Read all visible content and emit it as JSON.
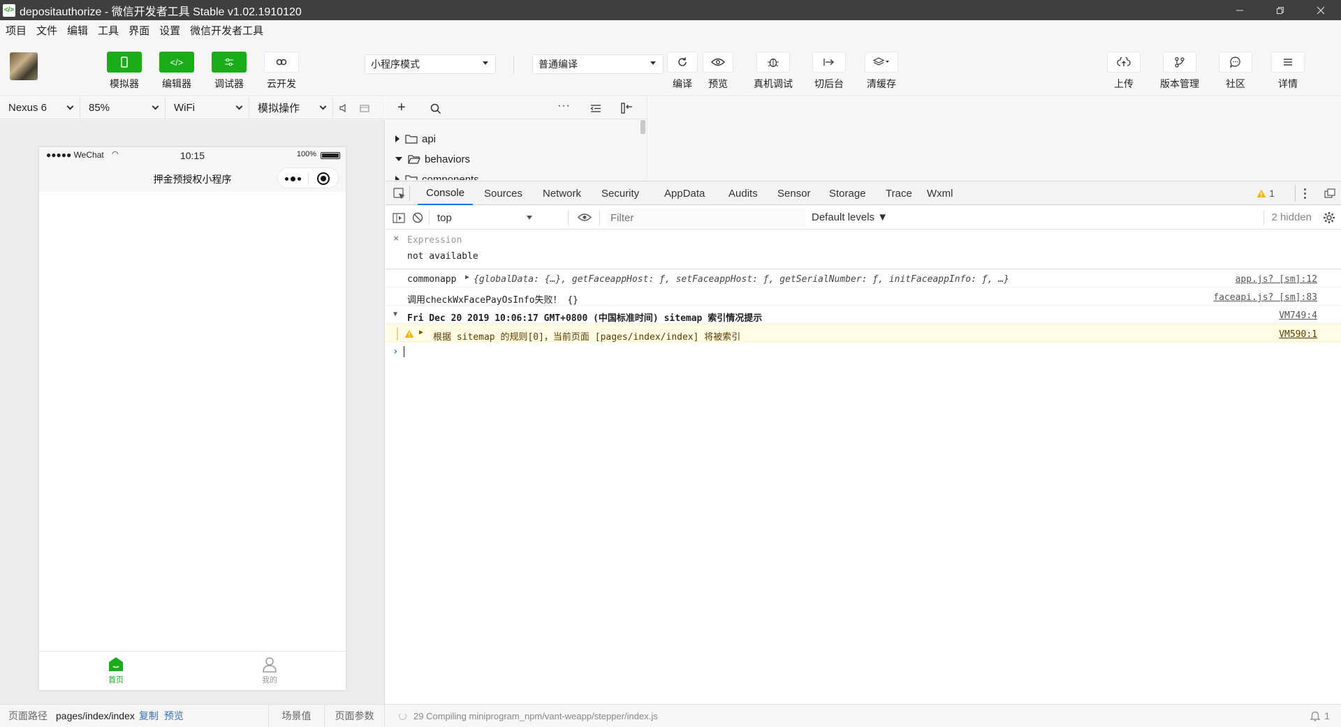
{
  "titlebar": {
    "title": "depositauthorize - 微信开发者工具 Stable v1.02.1910120"
  },
  "menu": [
    "项目",
    "文件",
    "编辑",
    "工具",
    "界面",
    "设置",
    "微信开发者工具"
  ],
  "toolbar": {
    "simulator": "模拟器",
    "editor": "编辑器",
    "debugger": "调试器",
    "cloud": "云开发",
    "mode_select": "小程序模式",
    "compile_select": "普通编译",
    "compile": "编译",
    "preview": "预览",
    "remote_debug": "真机调试",
    "background": "切后台",
    "clear_cache": "清缓存",
    "upload": "上传",
    "version": "版本管理",
    "community": "社区",
    "details": "详情"
  },
  "sim_bar": {
    "device": "Nexus 6",
    "zoom": "85%",
    "network": "WiFi",
    "operation": "模拟操作"
  },
  "phone": {
    "signal": "●●●●● WeChat",
    "time": "10:15",
    "battery": "100%",
    "nav_title": "押金预授权小程序",
    "tab_home": "首页",
    "tab_mine": "我的"
  },
  "file_tree": [
    {
      "name": "api",
      "expanded": false
    },
    {
      "name": "behaviors",
      "expanded": true
    },
    {
      "name": "components",
      "expanded": false
    }
  ],
  "devtools": {
    "tabs": [
      "Console",
      "Sources",
      "Network",
      "Security",
      "AppData",
      "Audits",
      "Sensor",
      "Storage",
      "Trace",
      "Wxml"
    ],
    "warning_count": "1",
    "context": "top",
    "filter_placeholder": "Filter",
    "levels": "Default levels ▼",
    "hidden": "2 hidden",
    "expression_label": "Expression",
    "expression_value": "not available",
    "logs": {
      "row1_name": "commonapp",
      "row1_obj": "{globalData: {…}, getFaceappHost: ƒ, setFaceappHost: ƒ, getSerialNumber: ƒ, initFaceappInfo: ƒ, …}",
      "row1_src": "app.js? [sm]:12",
      "row2_text": "调用checkWxFacePayOsInfo失败！ {}",
      "row2_src": "faceapi.js? [sm]:83",
      "row3_text": "Fri Dec 20 2019 10:06:17 GMT+0800 (中国标准时间) sitemap 索引情况提示",
      "row3_src": "VM749:4",
      "row4_text": "根据 sitemap 的规则[0]，当前页面 [pages/index/index] 将被索引",
      "row4_src": "VM590:1"
    }
  },
  "statusbar": {
    "path_label": "页面路径",
    "path": "pages/index/index",
    "copy": "复制",
    "preview": "预览",
    "scene": "场景值",
    "params": "页面参数",
    "compile_msg": "29 Compiling miniprogram_npm/vant-weapp/stepper/index.js",
    "notice_count": "1"
  },
  "colors": {
    "accent_green": "#1aad19",
    "titlebar": "#3f3f3f",
    "devtools_blue": "#1a73e8",
    "warning_bg": "#fffbe5"
  }
}
